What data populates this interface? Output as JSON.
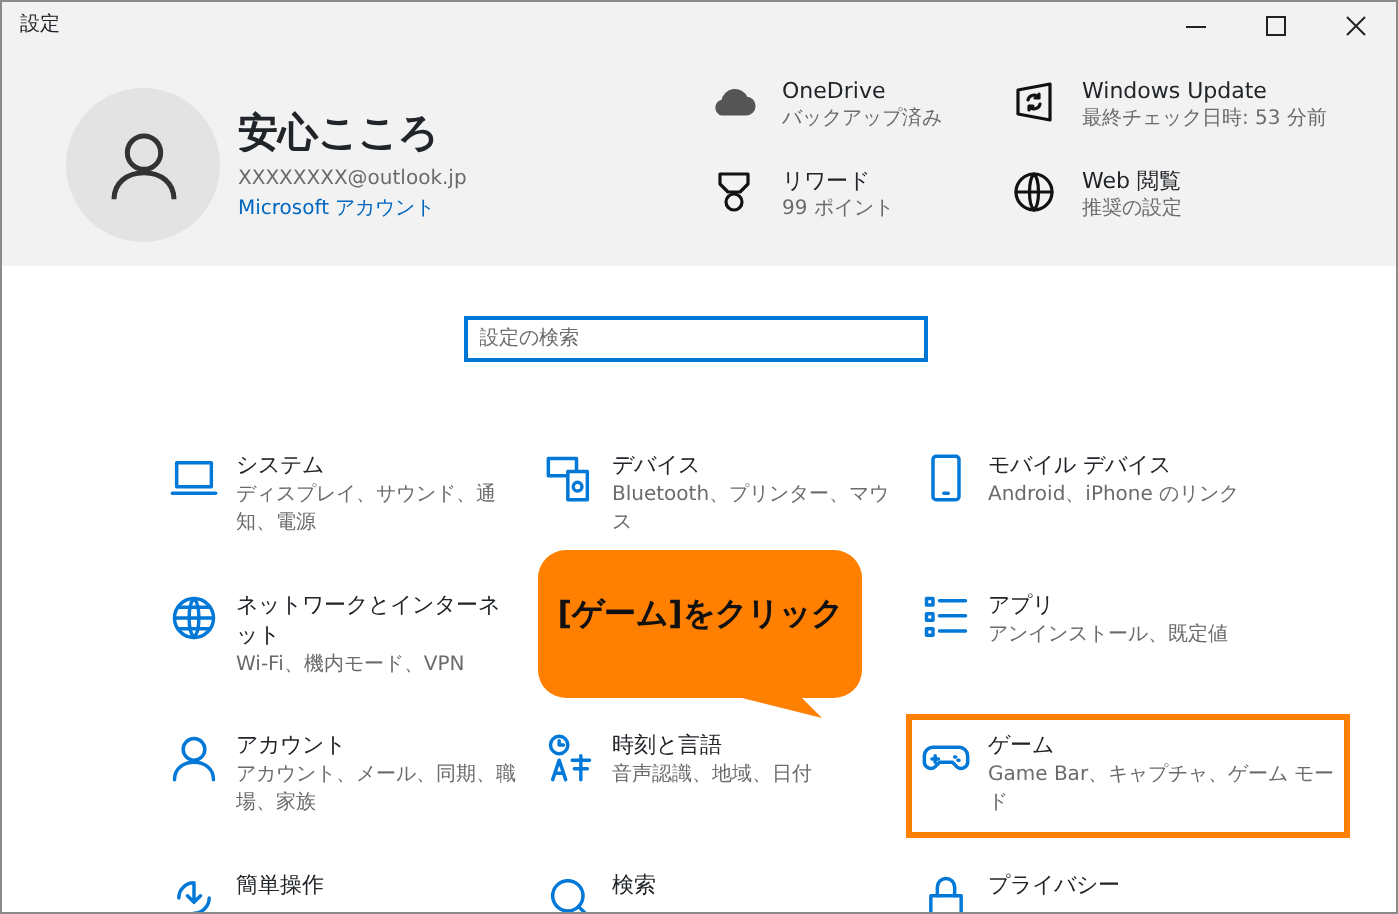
{
  "window": {
    "title": "設定"
  },
  "profile": {
    "name": "安心こころ",
    "email": "XXXXXXXX@outlook.jp",
    "link": "Microsoft アカウント"
  },
  "header_tiles": [
    {
      "title": "OneDrive",
      "subtitle": "バックアップ済み"
    },
    {
      "title": "Windows Update",
      "subtitle": "最終チェック日時: 53 分前"
    },
    {
      "title": "リワード",
      "subtitle": "99 ポイント"
    },
    {
      "title": "Web 閲覧",
      "subtitle": "推奨の設定"
    }
  ],
  "search": {
    "placeholder": "設定の検索"
  },
  "category_rows": [
    {
      "cells": [
        {
          "kind": "category",
          "title": "システム",
          "subtitle": "ディスプレイ、サウンド、通知、電源",
          "highlighted": false
        },
        {
          "kind": "category",
          "title": "デバイス",
          "subtitle": "Bluetooth、プリンター、マウス",
          "highlighted": false
        },
        {
          "kind": "category",
          "title": "モバイル デバイス",
          "subtitle": "Android、iPhone のリンク",
          "highlighted": false
        }
      ]
    },
    {
      "cells": [
        {
          "kind": "category",
          "title": "ネットワークとインターネット",
          "subtitle": "Wi-Fi、機内モード、VPN",
          "highlighted": false
        },
        {
          "kind": "callout",
          "text": "[ゲーム]をクリック"
        },
        {
          "kind": "category",
          "title": "アプリ",
          "subtitle": "アンインストール、既定値",
          "highlighted": false
        }
      ]
    },
    {
      "cells": [
        {
          "kind": "category",
          "title": "アカウント",
          "subtitle": "アカウント、メール、同期、職場、家族",
          "highlighted": false
        },
        {
          "kind": "category",
          "title": "時刻と言語",
          "subtitle": "音声認識、地域、日付",
          "highlighted": false
        },
        {
          "kind": "category",
          "title": "ゲーム",
          "subtitle": "Game Bar、キャプチャ、ゲーム モード",
          "highlighted": true
        }
      ]
    },
    {
      "cells": [
        {
          "kind": "category",
          "title": "簡単操作",
          "highlighted": false
        },
        {
          "kind": "category",
          "title": "検索",
          "highlighted": false
        },
        {
          "kind": "category",
          "title": "プライバシー",
          "highlighted": false
        }
      ]
    }
  ]
}
